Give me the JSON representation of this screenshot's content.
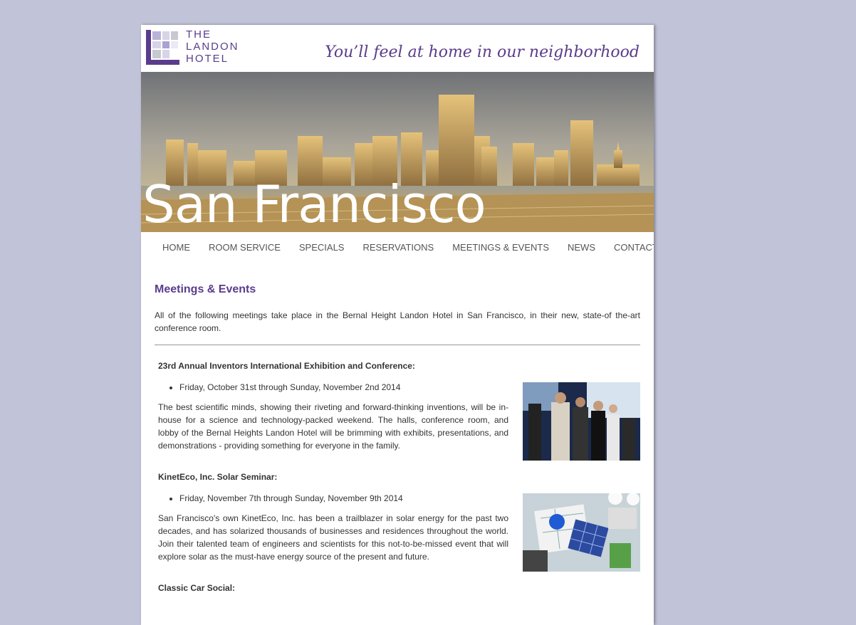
{
  "header": {
    "logo_line1": "THE",
    "logo_line2": "LANDON",
    "logo_line3": "HOTEL",
    "tagline": "You’ll feel at home in our neighborhood"
  },
  "hero": {
    "title": "San Francisco"
  },
  "nav": {
    "items": [
      "HOME",
      "ROOM SERVICE",
      "SPECIALS",
      "RESERVATIONS",
      "MEETINGS & EVENTS",
      "NEWS",
      "CONTACT"
    ]
  },
  "main": {
    "heading": "Meetings & Events",
    "intro": "All of the following meetings take place in the Bernal Height Landon Hotel in San Francisco, in their new, state-of the-art conference room.",
    "events": [
      {
        "title": "23rd Annual Inventors International Exhibition and Conference:",
        "date": "Friday, October 31st through Sunday, November 2nd 2014",
        "description": "The best scientific minds, showing their riveting and forward-thinking inventions, will be in-house for a science and technology-packed weekend. The halls, conference room, and lobby of the Bernal Heights Landon Hotel will be brimming with exhibits, presentations, and demonstrations - providing something for everyone in the family."
      },
      {
        "title": "KinetEco, Inc. Solar Seminar:",
        "date": "Friday, November 7th through Sunday, November 9th 2014",
        "description": "San Francisco's own KinetEco, Inc. has been a trailblazer in solar energy for the past two decades, and has solarized thousands of businesses and residences throughout the world. Join their talented team of engineers and scientists for this not-to-be-missed event that will explore solar as the must-have energy source of the present and future."
      },
      {
        "title": "Classic Car Social:"
      }
    ]
  },
  "colors": {
    "brand_purple": "#5b3c8c",
    "page_background": "#c1c4d8"
  }
}
